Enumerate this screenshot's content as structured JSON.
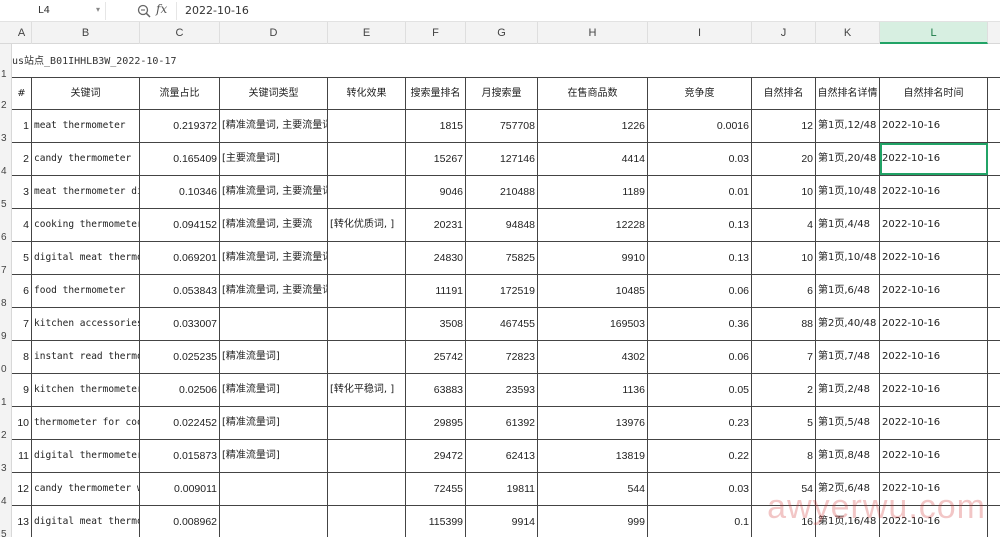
{
  "formula_bar": {
    "name_box": "L4",
    "zoom_icon": "zoom-icon",
    "fx_label": "fx",
    "formula_value": "2022-10-16"
  },
  "columns": [
    "A",
    "B",
    "C",
    "D",
    "E",
    "F",
    "G",
    "H",
    "I",
    "J",
    "K",
    "L"
  ],
  "active_column": "L",
  "row_numbers": [
    "1",
    "2",
    "3",
    "4",
    "5",
    "6",
    "7",
    "8",
    "9",
    "0",
    "1",
    "2",
    "3",
    "4",
    "5"
  ],
  "sheet_title": "us站点_B01IHHLB3W_2022-10-17",
  "headers": [
    "#",
    "关键词",
    "流量占比",
    "关键词类型",
    "转化效果",
    "搜索量排名",
    "月搜索量",
    "在售商品数",
    "竞争度",
    "自然排名",
    "自然排名详情",
    "自然排名时间"
  ],
  "rows": [
    [
      "1",
      "meat thermometer",
      "0.219372",
      "[精准流量词, 主要流量词]",
      "",
      "1815",
      "757708",
      "1226",
      "0.0016",
      "12",
      "第1页,12/48",
      "2022-10-16"
    ],
    [
      "2",
      "candy thermometer",
      "0.165409",
      "[主要流量词]",
      "",
      "15267",
      "127146",
      "4414",
      "0.03",
      "20",
      "第1页,20/48",
      "2022-10-16"
    ],
    [
      "3",
      "meat thermometer di",
      "0.10346",
      "[精准流量词, 主要流量词]",
      "",
      "9046",
      "210488",
      "1189",
      "0.01",
      "10",
      "第1页,10/48",
      "2022-10-16"
    ],
    [
      "4",
      "cooking thermometer",
      "0.094152",
      "[精准流量词, 主要流",
      "[转化优质词, ]",
      "20231",
      "94848",
      "12228",
      "0.13",
      "4",
      "第1页,4/48",
      "2022-10-16"
    ],
    [
      "5",
      "digital meat thermo",
      "0.069201",
      "[精准流量词, 主要流量词]",
      "",
      "24830",
      "75825",
      "9910",
      "0.13",
      "10",
      "第1页,10/48",
      "2022-10-16"
    ],
    [
      "6",
      "food thermometer",
      "0.053843",
      "[精准流量词, 主要流量词]",
      "",
      "11191",
      "172519",
      "10485",
      "0.06",
      "6",
      "第1页,6/48",
      "2022-10-16"
    ],
    [
      "7",
      "kitchen accessories",
      "0.033007",
      "",
      "",
      "3508",
      "467455",
      "169503",
      "0.36",
      "88",
      "第2页,40/48",
      "2022-10-16"
    ],
    [
      "8",
      "instant read thermo",
      "0.025235",
      "[精准流量词]",
      "",
      "25742",
      "72823",
      "4302",
      "0.06",
      "7",
      "第1页,7/48",
      "2022-10-16"
    ],
    [
      "9",
      "kitchen thermometer",
      "0.02506",
      "[精准流量词]",
      "[转化平稳词, ]",
      "63883",
      "23593",
      "1136",
      "0.05",
      "2",
      "第1页,2/48",
      "2022-10-16"
    ],
    [
      "10",
      "thermometer for coo",
      "0.022452",
      "[精准流量词]",
      "",
      "29895",
      "61392",
      "13976",
      "0.23",
      "5",
      "第1页,5/48",
      "2022-10-16"
    ],
    [
      "11",
      "digital thermometer",
      "0.015873",
      "[精准流量词]",
      "",
      "29472",
      "62413",
      "13819",
      "0.22",
      "8",
      "第1页,8/48",
      "2022-10-16"
    ],
    [
      "12",
      "candy thermometer w",
      "0.009011",
      "",
      "",
      "72455",
      "19811",
      "544",
      "0.03",
      "54",
      "第2页,6/48",
      "2022-10-16"
    ],
    [
      "13",
      "digital meat thermo",
      "0.008962",
      "",
      "",
      "115399",
      "9914",
      "999",
      "0.1",
      "16",
      "第1页,16/48",
      "2022-10-16"
    ]
  ],
  "selected_cell": {
    "row": 1,
    "col": 11
  },
  "watermark": "awyerwu.com"
}
